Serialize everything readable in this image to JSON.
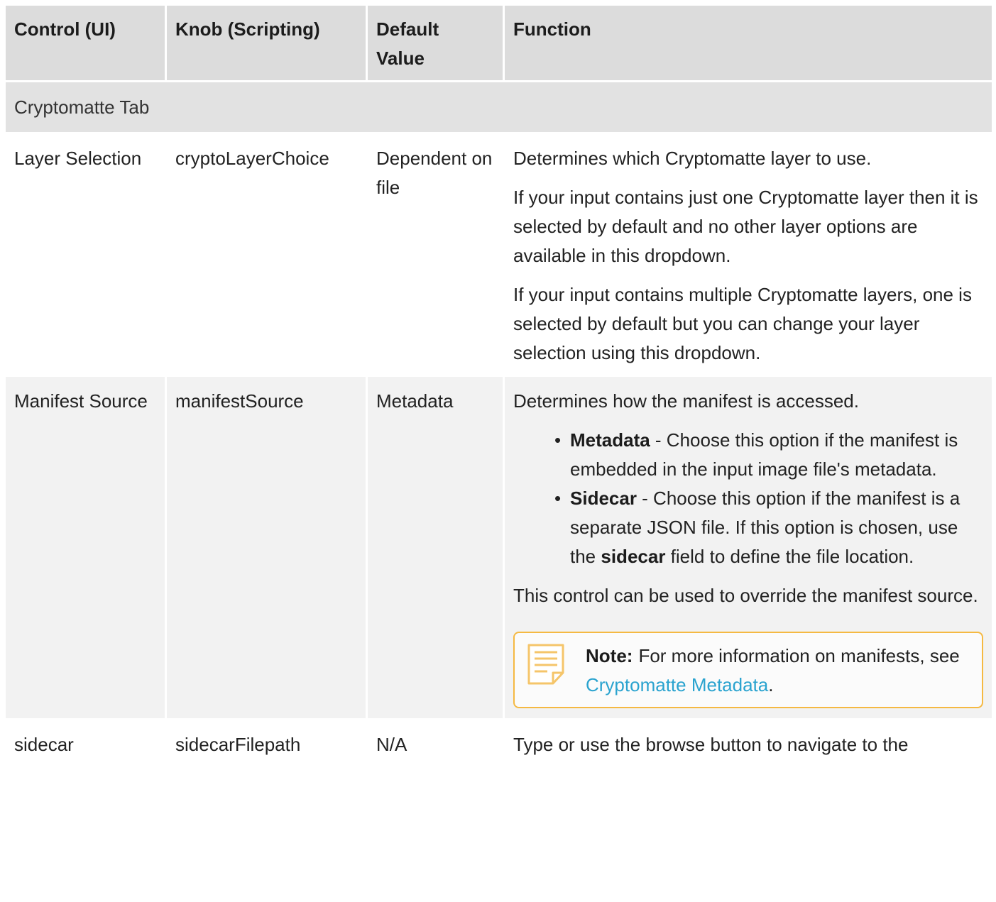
{
  "headers": {
    "control": "Control (UI)",
    "knob": "Knob (Scripting)",
    "default_line1": "Default",
    "default_line2": "Value",
    "function": "Function"
  },
  "section": {
    "title": "Cryptomatte Tab"
  },
  "rows": [
    {
      "control": "Layer Selection",
      "knob": "cryptoLayerChoice",
      "default": "Dependent on file",
      "paragraphs": [
        "Determines which Cryptomatte layer to use.",
        "If your input contains just one Cryptomatte layer then it is selected by default and no other layer options are available in this dropdown.",
        "If your input contains multiple Cryptomatte layers, one is selected by default but you can change your layer selection using this dropdown."
      ]
    },
    {
      "control": "Manifest Source",
      "knob": "manifestSource",
      "default": "Metadata",
      "intro": "Determines how the manifest is accessed.",
      "options": [
        {
          "name": "Metadata",
          "text": " - Choose this option if the manifest is embedded in the input image file's metadata."
        },
        {
          "name": "Sidecar",
          "text_before": " - Choose this option if the manifest is a separate JSON file. If this option is chosen, use the ",
          "field": "sidecar",
          "text_after": " field to define the file location."
        }
      ],
      "after": "This control can be used to override the manifest source.",
      "note": {
        "icon": "note-icon",
        "label": "Note:",
        "text": "For more information on manifests, see ",
        "link": "Cryptomatte Metadata",
        "suffix": ".",
        "border_color": "#f5b942",
        "link_color": "#2aa3cf"
      }
    },
    {
      "control": "sidecar",
      "knob": "sidecarFilepath",
      "default": "N/A",
      "function": "Type or use the browse button to navigate to the"
    }
  ],
  "bullet": "•"
}
